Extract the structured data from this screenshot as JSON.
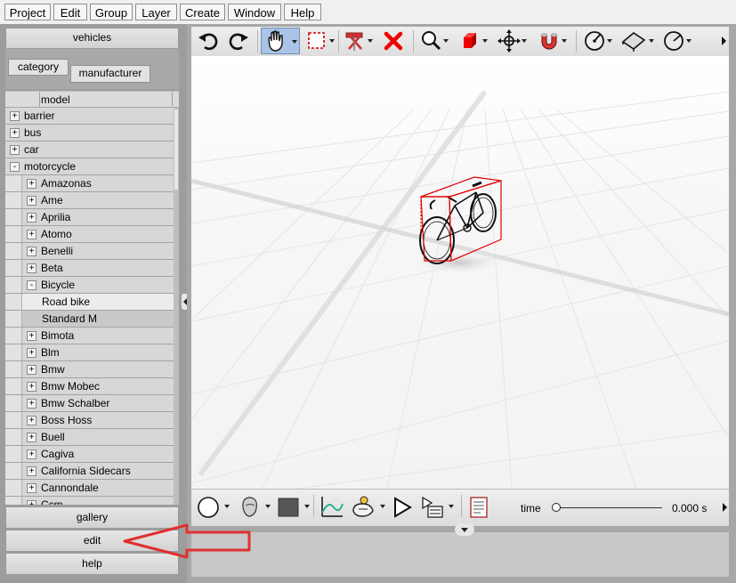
{
  "menubar": {
    "items": [
      "Project",
      "Edit",
      "Group",
      "Layer",
      "Create",
      "Window",
      "Help"
    ]
  },
  "left_panel": {
    "library_button": "vehicles",
    "tabs": {
      "category": "category",
      "manufacturer": "manufacturer"
    },
    "column_header": "model",
    "tree": [
      {
        "label": "barrier",
        "toggle": "+",
        "level": 0
      },
      {
        "label": "bus",
        "toggle": "+",
        "level": 0
      },
      {
        "label": "car",
        "toggle": "+",
        "level": 0
      },
      {
        "label": "motorcycle",
        "toggle": "-",
        "level": 0
      },
      {
        "label": "Amazonas",
        "toggle": "+",
        "level": 1
      },
      {
        "label": "Ame",
        "toggle": "+",
        "level": 1
      },
      {
        "label": "Aprilia",
        "toggle": "+",
        "level": 1
      },
      {
        "label": "Atomo",
        "toggle": "+",
        "level": 1
      },
      {
        "label": "Benelli",
        "toggle": "+",
        "level": 1
      },
      {
        "label": "Beta",
        "toggle": "+",
        "level": 1
      },
      {
        "label": "Bicycle",
        "toggle": "-",
        "level": 1
      },
      {
        "label": "Road bike",
        "toggle": "",
        "level": 2,
        "selected": true
      },
      {
        "label": "Standard M",
        "toggle": "",
        "level": 2
      },
      {
        "label": "Bimota",
        "toggle": "+",
        "level": 1
      },
      {
        "label": "Blm",
        "toggle": "+",
        "level": 1
      },
      {
        "label": "Bmw",
        "toggle": "+",
        "level": 1
      },
      {
        "label": "Bmw Mobec",
        "toggle": "+",
        "level": 1
      },
      {
        "label": "Bmw Schalber",
        "toggle": "+",
        "level": 1
      },
      {
        "label": "Boss Hoss",
        "toggle": "+",
        "level": 1
      },
      {
        "label": "Buell",
        "toggle": "+",
        "level": 1
      },
      {
        "label": "Cagiva",
        "toggle": "+",
        "level": 1
      },
      {
        "label": "California Sidecars",
        "toggle": "+",
        "level": 1
      },
      {
        "label": "Cannondale",
        "toggle": "+",
        "level": 1
      },
      {
        "label": "Ccm",
        "toggle": "+",
        "level": 1
      }
    ],
    "bottom_buttons": {
      "gallery": "gallery",
      "edit": "edit",
      "help": "help"
    }
  },
  "toolbar": {
    "tools": [
      "undo-icon",
      "redo-icon",
      "pan-hand-icon",
      "select-rectangle-icon",
      "cut-icon",
      "delete-icon",
      "zoom-icon",
      "cube-icon",
      "move-icon",
      "magnet-icon",
      "measure-icon",
      "plane-icon",
      "gauge-icon",
      "more-icon"
    ],
    "active_tool": "pan-hand-icon"
  },
  "bottom_bar": {
    "tools": [
      "circle-shape-icon",
      "head-icon",
      "color-swatch-icon",
      "graph-icon",
      "camera-icon",
      "play-icon",
      "render-list-icon",
      "document-icon"
    ],
    "time_label": "time",
    "time_value": "0.000 s",
    "time_slider_value": 0
  },
  "colors": {
    "selection_box": "#e00000",
    "active_tool_bg": "#a9c4e6",
    "annotation_arrow": "#e03030"
  }
}
